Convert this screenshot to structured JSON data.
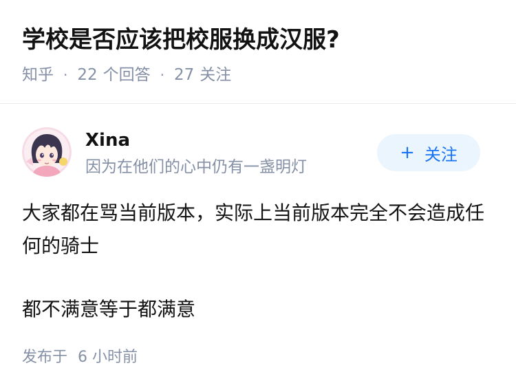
{
  "question": {
    "title": "学校是否应该把校服换成汉服?",
    "source": "知乎",
    "separator": "·",
    "answer_count": "22",
    "answer_unit": "个回答",
    "follower_count": "27",
    "follower_unit": "关注"
  },
  "author": {
    "name": "Xina",
    "bio": "因为在他们的心中仍有一盏明灯",
    "avatar_icon": "anime-avatar-icon",
    "follow_label": "关注",
    "follow_icon": "+"
  },
  "answer": {
    "paragraphs": [
      "大家都在骂当前版本，实际上当前版本完全不会造成任何的骑士",
      "都不满意等于都满意"
    ]
  },
  "publish": {
    "label": "发布于",
    "time": "6 小时前"
  },
  "colors": {
    "title": "#121212",
    "meta": "#8590a6",
    "accent": "#1772f6",
    "follow_bg": "#ebf5fd"
  }
}
